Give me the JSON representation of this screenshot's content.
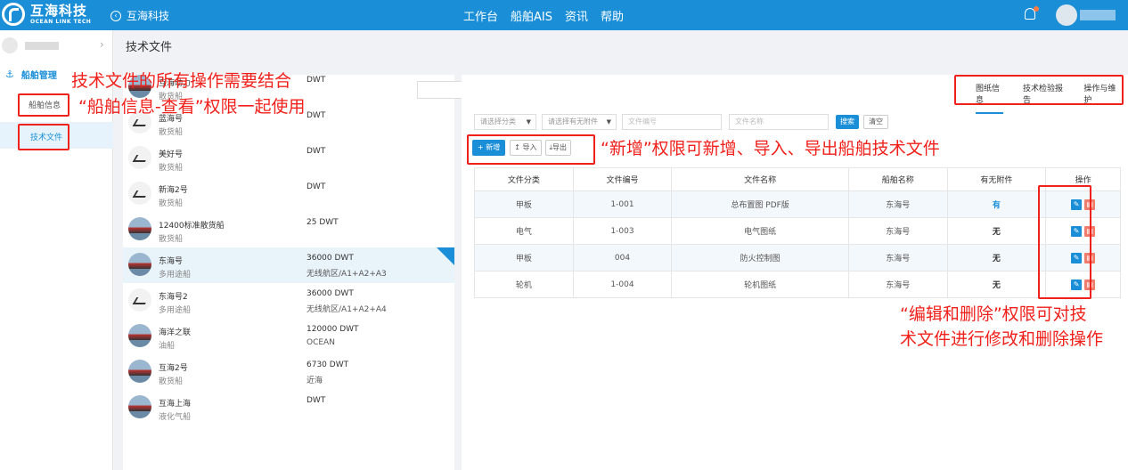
{
  "topbar": {
    "logo_cn": "互海科技",
    "logo_en": "OCEAN LINK TECH",
    "home_label": "互海科技",
    "nav": [
      "工作台",
      "船舶AIS",
      "资讯",
      "帮助"
    ]
  },
  "sidebar": {
    "group_label": "船舶管理",
    "items": [
      {
        "label": "船舶信息"
      },
      {
        "label": "技术文件"
      }
    ]
  },
  "breadcrumb": "技术文件",
  "ships": [
    {
      "name": "互海动力",
      "type": "散货船",
      "dwt": "DWT",
      "zone": "",
      "icon": "photo"
    },
    {
      "name": "蓝海号",
      "type": "散货船",
      "dwt": "DWT",
      "zone": "",
      "icon": "ship-silhouette"
    },
    {
      "name": "美好号",
      "type": "散货船",
      "dwt": "DWT",
      "zone": "",
      "icon": "ship-silhouette"
    },
    {
      "name": "新海2号",
      "type": "散货船",
      "dwt": "DWT",
      "zone": "",
      "icon": "ship-silhouette"
    },
    {
      "name": "12400标准散货船",
      "type": "散货船",
      "dwt": "25 DWT",
      "zone": "",
      "icon": "photo"
    },
    {
      "name": "东海号",
      "type": "多用途船",
      "dwt": "36000 DWT",
      "zone": "无线航区/A1+A2+A3",
      "icon": "photo",
      "selected": true
    },
    {
      "name": "东海号2",
      "type": "多用途船",
      "dwt": "36000 DWT",
      "zone": "无线航区/A1+A2+A4",
      "icon": "ship-silhouette"
    },
    {
      "name": "海洋之联",
      "type": "油船",
      "dwt": "120000 DWT",
      "zone": "OCEAN",
      "icon": "photo"
    },
    {
      "name": "互海2号",
      "type": "散货船",
      "dwt": "6730 DWT",
      "zone": "近海",
      "icon": "photo"
    },
    {
      "name": "互海上海",
      "type": "液化气船",
      "dwt": "DWT",
      "zone": "",
      "icon": "photo"
    }
  ],
  "tabs": [
    {
      "label": "图纸信息",
      "active": true
    },
    {
      "label": "技术检验报告",
      "active": false
    },
    {
      "label": "操作与维护",
      "active": false
    }
  ],
  "filters": {
    "category_placeholder": "请选择分类",
    "attachment_placeholder": "请选择有无附件",
    "file_no_placeholder": "文件编号",
    "file_name_placeholder": "文件名称",
    "search_label": "搜索",
    "clear_label": "清空"
  },
  "actions": {
    "add_label": "+ 新增",
    "import_label": "↥ 导入",
    "export_label": "⤓导出"
  },
  "table": {
    "headers": [
      "文件分类",
      "文件编号",
      "文件名称",
      "船舶名称",
      "有无附件",
      "操作"
    ],
    "rows": [
      {
        "category": "甲板",
        "no": "1-001",
        "name": "总布置图 PDF版",
        "ship": "东海号",
        "attachment": "有"
      },
      {
        "category": "电气",
        "no": "1-003",
        "name": "电气图纸",
        "ship": "东海号",
        "attachment": "无"
      },
      {
        "category": "甲板",
        "no": "004",
        "name": "防火控制图",
        "ship": "东海号",
        "attachment": "无"
      },
      {
        "category": "轮机",
        "no": "1-004",
        "name": "轮机图纸",
        "ship": "东海号",
        "attachment": "无"
      }
    ]
  },
  "annotations": {
    "a1_line1": "技术文件的所有操作需要结合",
    "a1_line2": "“船舶信息-查看”权限一起使用",
    "a2": "“新增”权限可新增、导入、导出船舶技术文件",
    "a3_line1": "“编辑和删除”权限可对技",
    "a3_line2": "术文件进行修改和删除操作"
  },
  "colors": {
    "primary": "#1a8fd8",
    "annotation_red": "#f0201a",
    "delete_orange": "#f07c6c"
  }
}
